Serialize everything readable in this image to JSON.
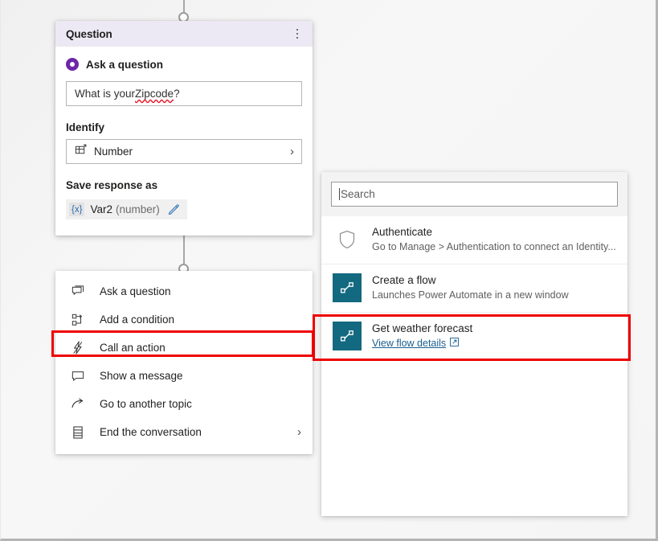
{
  "question_card": {
    "title": "Question",
    "menu_icon": "kebab-menu-icon",
    "ask_option_label": "Ask a question",
    "question_text_before": "What is your ",
    "question_text_misspelled": "Zipcode",
    "question_text_after": "?",
    "identify_label": "Identify",
    "identify_value": "Number",
    "identify_icon": "entity-number-icon",
    "identify_chevron": "›",
    "save_response_label": "Save response as",
    "variable_token": "{x}",
    "variable_name": "Var2",
    "variable_type": "(number)",
    "edit_icon": "pencil-icon"
  },
  "node_menu": {
    "items": [
      {
        "label": "Ask a question",
        "icon": "ask-question-icon",
        "chevron": "",
        "highlighted": false
      },
      {
        "label": "Add a condition",
        "icon": "condition-icon",
        "chevron": "",
        "highlighted": false
      },
      {
        "label": "Call an action",
        "icon": "lightning-bolt-icon",
        "chevron": "",
        "highlighted": true
      },
      {
        "label": "Show a message",
        "icon": "message-icon",
        "chevron": "",
        "highlighted": false
      },
      {
        "label": "Go to another topic",
        "icon": "arrow-redirect-icon",
        "chevron": "",
        "highlighted": false
      },
      {
        "label": "End the conversation",
        "icon": "end-conversation-icon",
        "chevron": "›",
        "highlighted": false
      }
    ]
  },
  "action_panel": {
    "search_placeholder": "Search",
    "search_value": "",
    "items": [
      {
        "title": "Authenticate",
        "subtitle": "Go to Manage > Authentication to connect an Identity...",
        "icon": "shield-icon",
        "icon_style": "outline",
        "link": "",
        "highlighted": false
      },
      {
        "title": "Create a flow",
        "subtitle": "Launches Power Automate in a new window",
        "icon": "flow-icon",
        "icon_style": "tile",
        "link": "",
        "highlighted": false
      },
      {
        "title": "Get weather forecast",
        "subtitle": "",
        "icon": "flow-icon",
        "icon_style": "tile",
        "link": "View flow details",
        "link_icon": "external-link-icon",
        "highlighted": true
      }
    ]
  },
  "colors": {
    "header_background": "#ece9f4",
    "radio_accent": "#6c27a8",
    "flow_tile": "#13697f",
    "highlight_red": "#ee0000",
    "link_blue": "#1b5f8f",
    "variable_token_blue": "#2a6fb5",
    "canvas": "#f5f5f5"
  }
}
